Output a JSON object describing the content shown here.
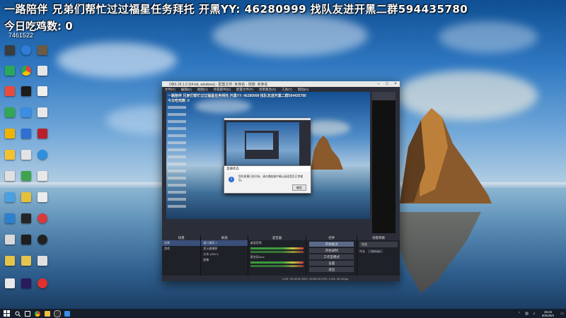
{
  "overlay": {
    "line1": "一路陪伴  兄弟们帮忙过过福星任务拜托  开黑YY: 46280999  找队友进开黑二群594435780",
    "line2": "今日吃鸡数: 0",
    "id_text": "7461522"
  },
  "obs": {
    "title": "OBS 26.1.0 (64-bit, windows) - 配置文件: 未命名 - 场景: 未命名",
    "menu": [
      "文件(F)",
      "编辑(E)",
      "视图(V)",
      "停靠部件(D)",
      "配置文件(P)",
      "场景集合(S)",
      "工具(T)",
      "帮助(H)"
    ],
    "dock_headers": [
      "场景",
      "来源",
      "混音器",
      "场景转换",
      "控件"
    ],
    "scene_items": [
      "场景",
      "游戏"
    ],
    "source_items": [
      "窗口捕获 2",
      "显示器捕获",
      "文本 (GDI+)",
      "图像"
    ],
    "mixer_items": [
      "桌面音频",
      "麦克风/Aux"
    ],
    "controls": [
      "开始推流",
      "开始录制",
      "工作室模式",
      "设置",
      "退出"
    ],
    "transition": {
      "type": "渐变",
      "duration_label": "时长",
      "duration": "300 ms"
    },
    "status": "LIVE: 00:00:00   REC: 00:00:00   CPU: 2.3%, 30.00 fps",
    "dialog": {
      "title": "直播状态",
      "message": "您的直播已经开始，请在播放器中确认画面是否正常输出。",
      "ok": "确定"
    }
  },
  "taskbar": {
    "time": "15:24",
    "date": "2021/6/1"
  }
}
